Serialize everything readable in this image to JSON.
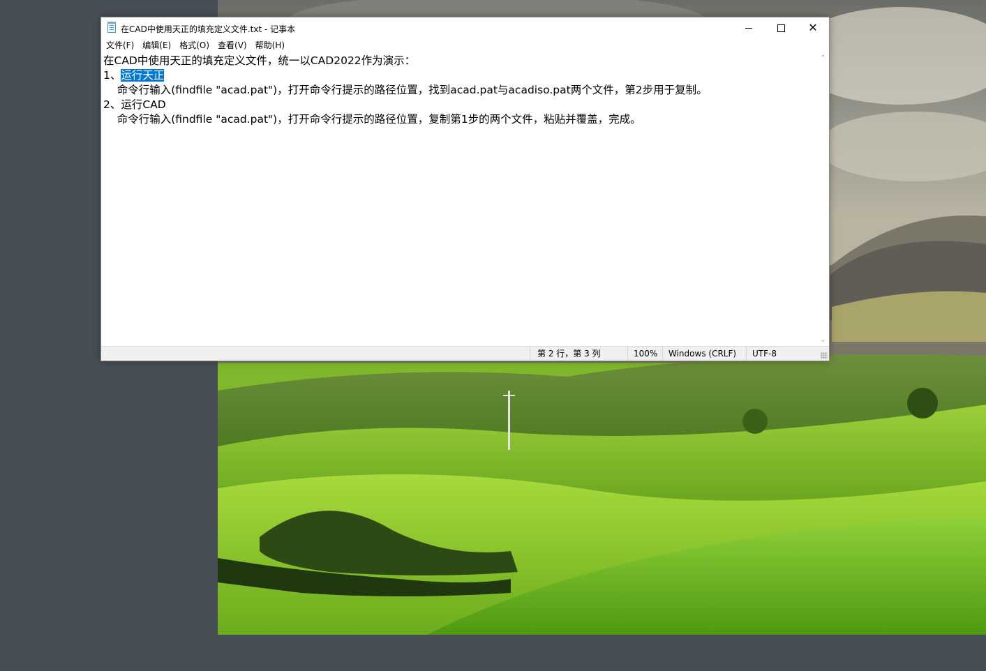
{
  "window": {
    "title": "在CAD中使用天正的填充定义文件.txt - 记事本"
  },
  "menu": [
    {
      "label": "文件(F)"
    },
    {
      "label": "编辑(E)"
    },
    {
      "label": "格式(O)"
    },
    {
      "label": "查看(V)"
    },
    {
      "label": "帮助(H)"
    }
  ],
  "editor": {
    "line1": "在CAD中使用天正的填充定义文件，统一以CAD2022作为演示：",
    "line2_prefix": "1、",
    "line2_selected": "运行天正",
    "line3": "    命令行输入(findfile \"acad.pat\")，打开命令行提示的路径位置，找到acad.pat与acadiso.pat两个文件，第2步用于复制。",
    "line4": "2、运行CAD",
    "line5": "    命令行输入(findfile \"acad.pat\")，打开命令行提示的路径位置，复制第1步的两个文件，粘贴并覆盖，完成。"
  },
  "statusbar": {
    "position": "第 2 行，第 3 列",
    "zoom": "100%",
    "line_ending": "Windows (CRLF)",
    "encoding": "UTF-8"
  },
  "icons": {
    "app": "notepad-icon",
    "minimize": "minimize-icon",
    "maximize": "maximize-icon",
    "close": "close-icon"
  },
  "colors": {
    "selection": "#0078d7",
    "desktop": "#474e55"
  }
}
